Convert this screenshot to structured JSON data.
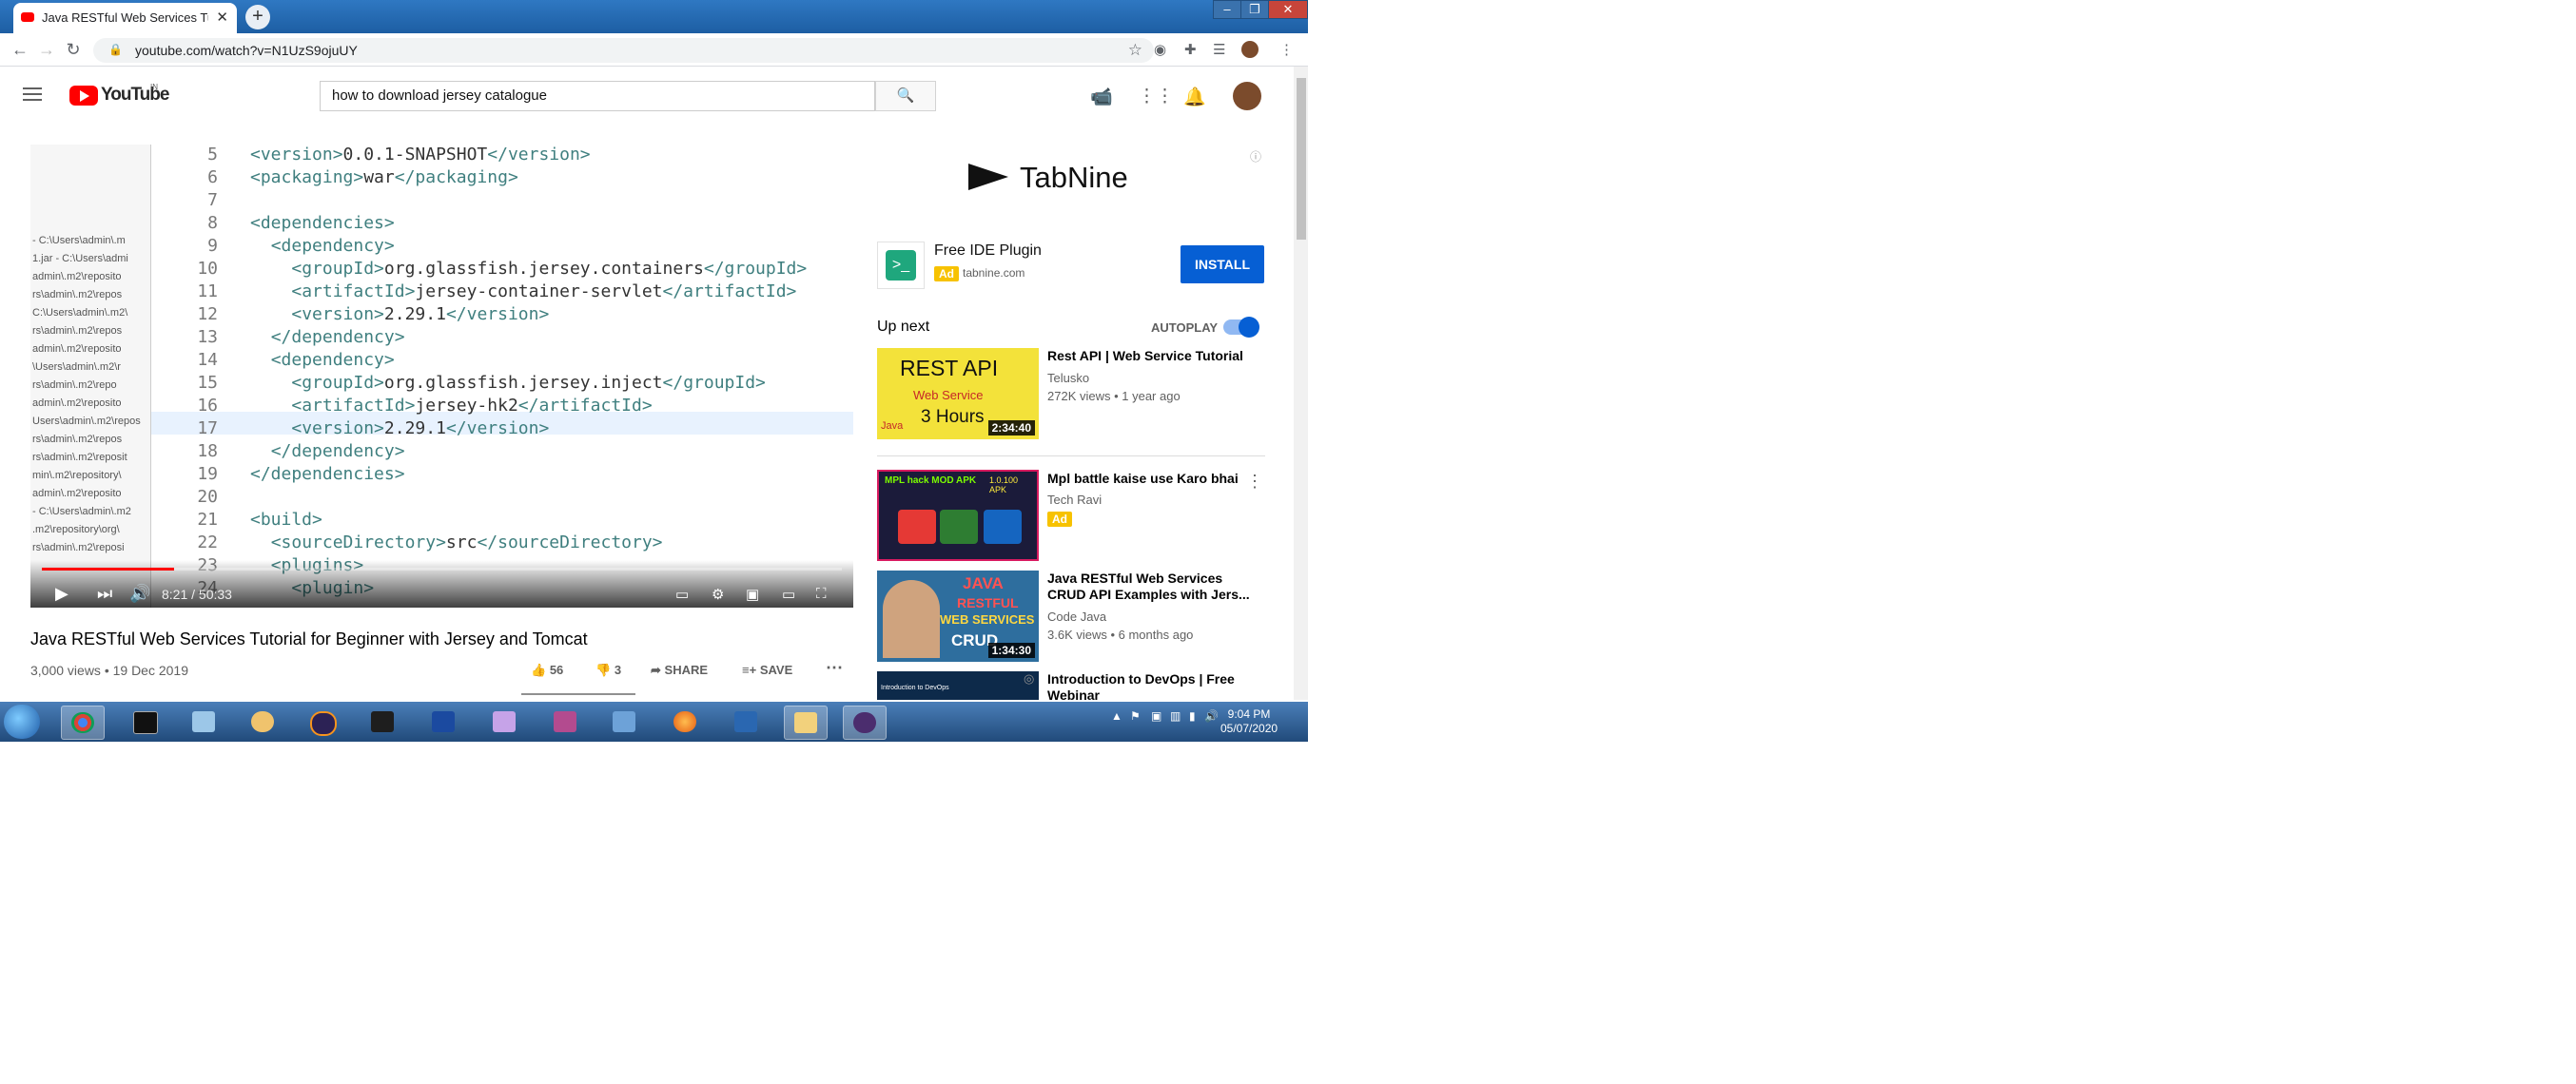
{
  "browser": {
    "tab_title": "Java RESTful Web Services Tutor",
    "url": "youtube.com/watch?v=N1UzS9ojuUY"
  },
  "youtube": {
    "logo_text": "YouTube",
    "region": "IN",
    "search_value": "how to download jersey catalogue"
  },
  "video": {
    "sidebar_paths": [
      "- C:\\Users\\admin\\.m",
      "1.jar - C:\\Users\\admi",
      "admin\\.m2\\reposito",
      "rs\\admin\\.m2\\repos",
      "C:\\Users\\admin\\.m2\\",
      "rs\\admin\\.m2\\repos",
      "admin\\.m2\\reposito",
      "\\Users\\admin\\.m2\\r",
      "rs\\admin\\.m2\\repo",
      "admin\\.m2\\reposito",
      "Users\\admin\\.m2\\repos",
      "rs\\admin\\.m2\\repos",
      "rs\\admin\\.m2\\reposit",
      "min\\.m2\\repository\\",
      "admin\\.m2\\reposito",
      "- C:\\Users\\admin\\.m2",
      ".m2\\repository\\org\\",
      "rs\\admin\\.m2\\reposi"
    ],
    "code_lines": [
      {
        "n": "5",
        "pre": "<version>",
        "mid": "0.0.1-SNAPSHOT",
        "post": "</version>",
        "indent": ""
      },
      {
        "n": "6",
        "pre": "<packaging>",
        "mid": "war",
        "post": "</packaging>",
        "indent": ""
      },
      {
        "n": "7",
        "pre": "",
        "mid": "",
        "post": "",
        "indent": ""
      },
      {
        "n": "8",
        "pre": "<dependencies>",
        "mid": "",
        "post": "",
        "indent": ""
      },
      {
        "n": "9",
        "pre": "<dependency>",
        "mid": "",
        "post": "",
        "indent": "  "
      },
      {
        "n": "10",
        "pre": "<groupId>",
        "mid": "org.glassfish.jersey.containers",
        "post": "</groupId>",
        "indent": "    "
      },
      {
        "n": "11",
        "pre": "<artifactId>",
        "mid": "jersey-container-servlet",
        "post": "</artifactId>",
        "indent": "    "
      },
      {
        "n": "12",
        "pre": "<version>",
        "mid": "2.29.1",
        "post": "</version>",
        "indent": "    "
      },
      {
        "n": "13",
        "pre": "</dependency>",
        "mid": "",
        "post": "",
        "indent": "  "
      },
      {
        "n": "14",
        "pre": "<dependency>",
        "mid": "",
        "post": "",
        "indent": "  "
      },
      {
        "n": "15",
        "pre": "<groupId>",
        "mid": "org.glassfish.jersey.inject",
        "post": "</groupId>",
        "indent": "    "
      },
      {
        "n": "16",
        "pre": "<artifactId>",
        "mid": "jersey-hk2",
        "post": "</artifactId>",
        "indent": "    "
      },
      {
        "n": "17",
        "pre": "<version>",
        "mid": "2.29.1",
        "post": "</version>",
        "indent": "    "
      },
      {
        "n": "18",
        "pre": "</dependency>",
        "mid": "",
        "post": "",
        "indent": "  "
      },
      {
        "n": "19",
        "pre": "</dependencies>",
        "mid": "",
        "post": "",
        "indent": ""
      },
      {
        "n": "20",
        "pre": "",
        "mid": "",
        "post": "",
        "indent": ""
      },
      {
        "n": "21",
        "pre": "<build>",
        "mid": "",
        "post": "",
        "indent": ""
      },
      {
        "n": "22",
        "pre": "<sourceDirectory>",
        "mid": "src",
        "post": "</sourceDirectory>",
        "indent": "  "
      },
      {
        "n": "23",
        "pre": "<plugins>",
        "mid": "",
        "post": "",
        "indent": "  "
      },
      {
        "n": "24",
        "pre": "<plugin>",
        "mid": "",
        "post": "",
        "indent": "    "
      }
    ],
    "time": "8:21 / 50:33",
    "progress_fraction": 0.165,
    "title": "Java RESTful Web Services Tutorial for Beginner with Jersey and Tomcat",
    "views_date": "3,000 views • 19 Dec 2019",
    "likes": "56",
    "dislikes": "3",
    "share_label": "SHARE",
    "save_label": "SAVE"
  },
  "ad": {
    "brand": "TabNine",
    "product": "Free IDE Plugin",
    "badge": "Ad",
    "domain": "tabnine.com",
    "install_label": "INSTALL"
  },
  "sidebar": {
    "up_next": "Up next",
    "autoplay": "AUTOPLAY",
    "videos": [
      {
        "title": "Rest API | Web Service Tutorial",
        "channel": "Telusko",
        "meta": "272K views • 1 year ago",
        "duration": "2:34:40",
        "thumb_text": "REST API",
        "thumb_sub": "Web Service",
        "thumb_sub2": "3 Hours",
        "thumb_corner": "Java"
      },
      {
        "title": "Mpl battle kaise use Karo bhai",
        "channel": "Tech Ravi",
        "meta": "",
        "duration": "",
        "badge": "Ad",
        "thumb_text": "MPL hack MOD APK",
        "thumb_sub": "1.0.100 APK"
      },
      {
        "title": "Java RESTful Web Services CRUD API Examples with Jers...",
        "channel": "Code Java",
        "meta": "3.6K views • 6 months ago",
        "duration": "1:34:30",
        "thumb_text": "JAVA",
        "thumb_sub": "RESTFUL",
        "thumb_sub2": "WEB SERVICES",
        "thumb_sub3": "CRUD"
      },
      {
        "title": "Introduction to DevOps | Free Webinar",
        "channel": "",
        "meta": "",
        "duration": "",
        "thumb_text": "Introduction to DevOps"
      }
    ]
  },
  "taskbar": {
    "time": "9:04 PM",
    "date": "05/07/2020"
  },
  "colors": {
    "yt_red": "#ff0000",
    "blue": "#065fd4",
    "tag": "#3f7f7f"
  }
}
